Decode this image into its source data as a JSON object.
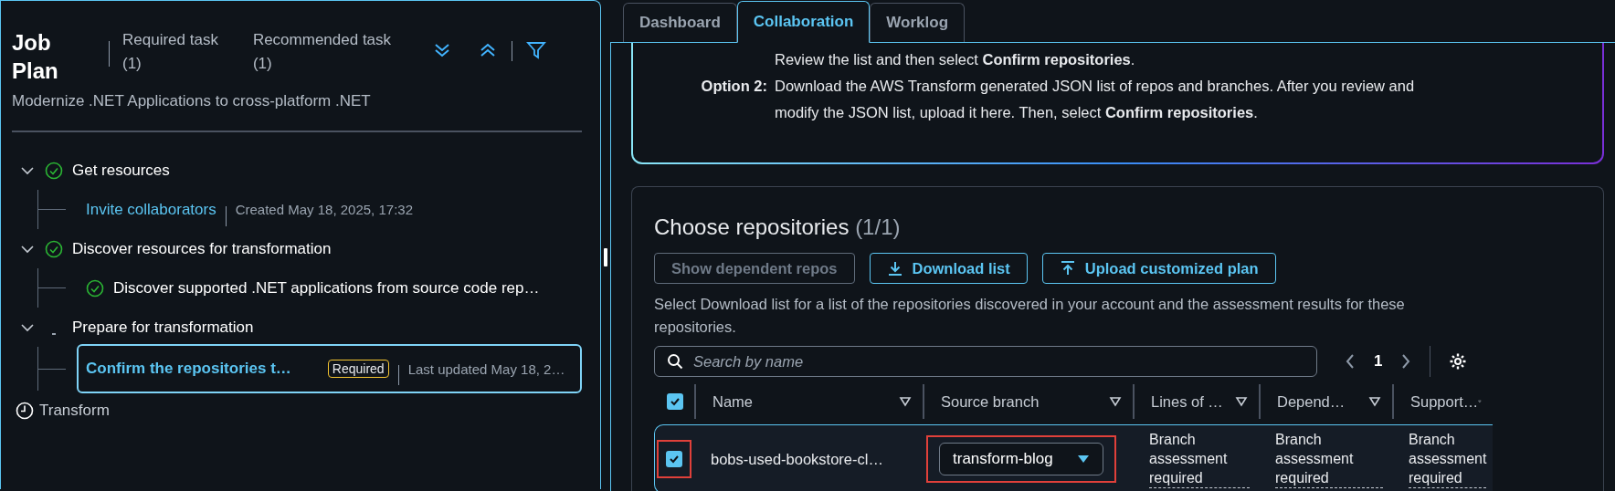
{
  "job_plan": {
    "title": "Job Plan",
    "counters": [
      {
        "label": "Required task",
        "count": "(1)"
      },
      {
        "label": "Recommended task",
        "count": "(1)"
      }
    ],
    "subtitle": "Modernize .NET Applications to cross-platform .NET",
    "steps": [
      {
        "label": "Get resources",
        "kind": "done",
        "expanded": true,
        "children": [
          {
            "kind": "link",
            "label": "Invite collaborators",
            "meta": "Created May 18, 2025, 17:32",
            "selected": false
          }
        ]
      },
      {
        "label": "Discover resources for transformation",
        "kind": "done",
        "expanded": true,
        "children": [
          {
            "kind": "task",
            "label": "Discover supported .NET applications from source code rep…",
            "selected": false
          }
        ]
      },
      {
        "label": "Prepare for transformation",
        "kind": "in_progress",
        "expanded": true,
        "children": [
          {
            "kind": "link",
            "label": "Confirm the repositories t…",
            "badge": "Required",
            "meta": "Last updated May 18, 2…",
            "selected": true
          }
        ]
      },
      {
        "label": "Transform",
        "kind": "pending",
        "expanded": false
      }
    ]
  },
  "tabs": [
    {
      "label": "Dashboard",
      "selected": false
    },
    {
      "label": "Collaboration",
      "selected": true
    },
    {
      "label": "Worklog",
      "selected": false
    }
  ],
  "info": {
    "options": [
      {
        "text": "Review the list and then select **Confirm repositories**."
      },
      {
        "label": "Option 2:",
        "text": "Download the AWS Transform generated JSON list of repos and branches. After you review and modify the JSON list, upload it here. Then, select **Confirm repositories**."
      }
    ]
  },
  "repositories": {
    "title": "Choose repositories",
    "count": "(1/1)",
    "buttons": [
      {
        "label": "Show dependent repos",
        "disabled": true
      },
      {
        "label": "Download list",
        "disabled": false
      },
      {
        "label": "Upload customized plan",
        "disabled": false
      }
    ],
    "description": "Select Download list for a list of the repositories discovered in your account and the assessment results for these repositories.",
    "search": {
      "placeholder": "Search by name"
    },
    "page": "1",
    "all_checked": true,
    "columns": [
      "Name",
      "Source branch",
      "Lines of …",
      "Depend…",
      "Support…"
    ],
    "rows": [
      {
        "checked": true,
        "checkbox_highlighted": true,
        "branch_highlighted": true,
        "cells": [
          "bobs-used-bookstore-cl…",
          "transform-blog",
          "Branch assessment required",
          "Branch assessment required",
          "Branch assessment required"
        ]
      }
    ]
  }
}
